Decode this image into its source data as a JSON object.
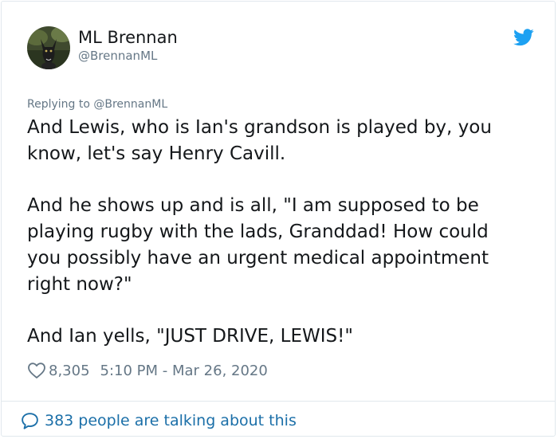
{
  "author": {
    "name": "ML Brennan",
    "handle": "@BrennanML"
  },
  "reply": {
    "text": "Replying to @BrennanML"
  },
  "tweet": {
    "paragraphs": [
      "And Lewis, who is Ian's grandson is played by, you know, let's say Henry Cavill.",
      "And he shows up and is all, \"I am supposed to be playing rugby with the lads, Granddad! How could you possibly have an urgent medical appointment right now?\"",
      "And Ian yells, \"JUST DRIVE, LEWIS!\""
    ]
  },
  "meta": {
    "likes": "8,305",
    "timestamp": "5:10 PM - Mar 26, 2020"
  },
  "footer": {
    "talking": "383 people are talking about this"
  },
  "icons": {
    "brand": "twitter-bird-icon",
    "like": "heart-icon",
    "conversation": "speech-bubble-icon"
  },
  "colors": {
    "twitter_blue": "#1da1f2",
    "link_blue": "#1b6fa8",
    "secondary_text": "#657786",
    "primary_text": "#14171a",
    "border": "#e1e8ed"
  }
}
